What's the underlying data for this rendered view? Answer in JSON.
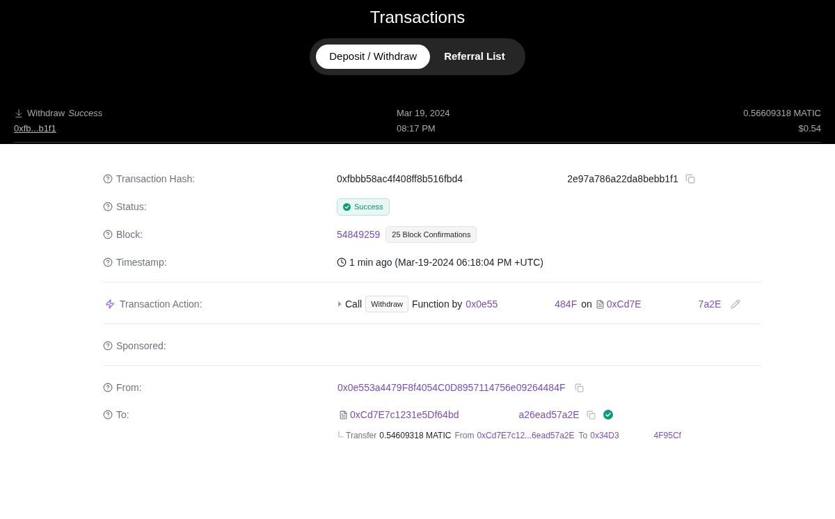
{
  "header": {
    "title": "Transactions",
    "tabs": [
      {
        "label": "Deposit / Withdraw",
        "selected": true
      },
      {
        "label": "Referral List",
        "selected": false
      }
    ]
  },
  "transactions": [
    {
      "type": "Withdraw",
      "status": "Success",
      "hash": "0xfb...b1f1",
      "date": "Mar 19, 2024",
      "time": "08:17 PM",
      "amount": "0.56609318 MATIC",
      "fiat": "$0.54"
    }
  ],
  "details": {
    "sections": [
      {
        "rows": [
          {
            "kind": "hash",
            "label": "Transaction Hash:",
            "parts": [
              "0xfbbb58ac4f408ff8b516fbd4",
              "2e97a786a22da8bebb1f1"
            ]
          },
          {
            "kind": "status",
            "label": "Status:",
            "badge": "Success"
          },
          {
            "kind": "block",
            "label": "Block:",
            "block": "54849259",
            "confirmations": "25 Block Confirmations"
          },
          {
            "kind": "timestamp",
            "label": "Timestamp:",
            "value": "1 min ago (Mar-19-2024 06:18:04 PM +UTC)"
          }
        ]
      },
      {
        "rows": [
          {
            "kind": "action",
            "label": "Transaction Action:",
            "call": "Call",
            "method": "Withdraw",
            "function_by": "Function by",
            "caller_parts": [
              "0x0e55",
              "484F"
            ],
            "on": "on",
            "contract_parts": [
              "0xCd7E",
              "7a2E"
            ]
          }
        ]
      },
      {
        "rows": [
          {
            "kind": "empty",
            "label": "Sponsored:"
          }
        ]
      },
      {
        "rows": [
          {
            "kind": "address",
            "label": "From:",
            "address": "0x0e553a4479F8f4054C0D8957114756e09264484F"
          },
          {
            "kind": "contract",
            "label": "To:",
            "parts": [
              "0xCd7E7c1231e5Df64bd",
              "a26ead57a2E"
            ],
            "verified": true,
            "transfers": [
              {
                "label": "Transfer",
                "amount": "0.54609318 MATIC",
                "from_label": "From",
                "from": "0xCd7E7c12...6ead57a2E",
                "to_label": "To",
                "to_parts": [
                  "0x34D3",
                  "4F95Cf"
                ]
              }
            ]
          }
        ]
      }
    ]
  }
}
